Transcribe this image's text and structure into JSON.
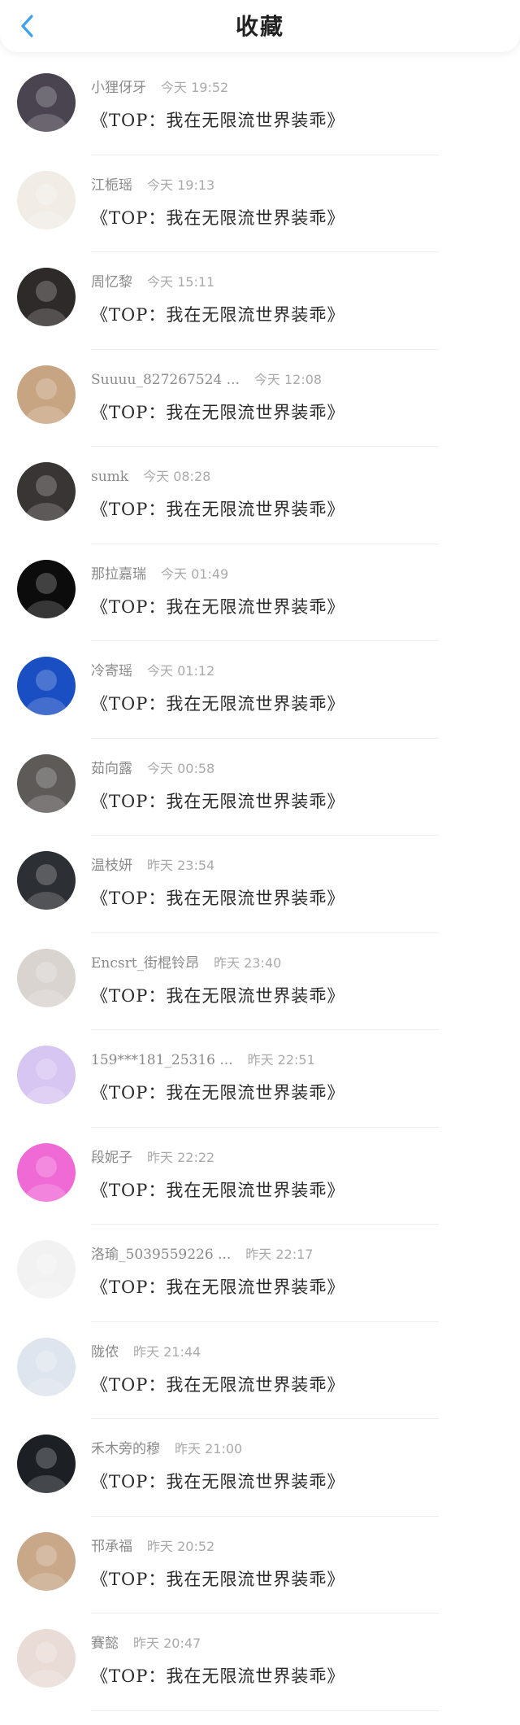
{
  "header": {
    "title": "收藏",
    "back_icon": "chevron-left-icon",
    "accent": "#3aa0f0"
  },
  "items": [
    {
      "name": "小狸伢牙",
      "time": "今天 19:52",
      "book": "《TOP：我在无限流世界装乖》",
      "avatar_color": "#4a4450"
    },
    {
      "name": "江栀瑶",
      "time": "今天 19:13",
      "book": "《TOP：我在无限流世界装乖》",
      "avatar_color": "#f1ece6"
    },
    {
      "name": "周忆黎",
      "time": "今天 15:11",
      "book": "《TOP：我在无限流世界装乖》",
      "avatar_color": "#2f2a2a"
    },
    {
      "name": "Suuuu_827267524 ...",
      "time": "今天 12:08",
      "book": "《TOP：我在无限流世界装乖》",
      "avatar_color": "#c8a582"
    },
    {
      "name": "sumk",
      "time": "今天 08:28",
      "book": "《TOP：我在无限流世界装乖》",
      "avatar_color": "#3a3535"
    },
    {
      "name": "那拉嘉瑞",
      "time": "今天 01:49",
      "book": "《TOP：我在无限流世界装乖》",
      "avatar_color": "#0c0c0c"
    },
    {
      "name": "冷寄瑶",
      "time": "今天 01:12",
      "book": "《TOP：我在无限流世界装乖》",
      "avatar_color": "#1a4fc4"
    },
    {
      "name": "茹向露",
      "time": "今天 00:58",
      "book": "《TOP：我在无限流世界装乖》",
      "avatar_color": "#5d5a58"
    },
    {
      "name": "温枝妍",
      "time": "昨天 23:54",
      "book": "《TOP：我在无限流世界装乖》",
      "avatar_color": "#2c2f33"
    },
    {
      "name": "Encsrt_街棍铃昂",
      "time": "昨天 23:40",
      "book": "《TOP：我在无限流世界装乖》",
      "avatar_color": "#d9d4d0"
    },
    {
      "name": "159***181_25316 ...",
      "time": "昨天 22:51",
      "book": "《TOP：我在无限流世界装乖》",
      "avatar_color": "#d8c6f2"
    },
    {
      "name": "段妮子",
      "time": "昨天 22:22",
      "book": "《TOP：我在无限流世界装乖》",
      "avatar_color": "#f06ad6"
    },
    {
      "name": "洛瑜_5039559226 ...",
      "time": "昨天 22:17",
      "book": "《TOP：我在无限流世界装乖》",
      "avatar_color": "#f2f2f2"
    },
    {
      "name": "陇侬",
      "time": "昨天 21:44",
      "book": "《TOP：我在无限流世界装乖》",
      "avatar_color": "#dfe5ee"
    },
    {
      "name": "禾木旁的穆",
      "time": "昨天 21:00",
      "book": "《TOP：我在无限流世界装乖》",
      "avatar_color": "#1c1f24"
    },
    {
      "name": "邗承福",
      "time": "昨天 20:52",
      "book": "《TOP：我在无限流世界装乖》",
      "avatar_color": "#c9a88a"
    },
    {
      "name": "賽懿",
      "time": "昨天 20:47",
      "book": "《TOP：我在无限流世界装乖》",
      "avatar_color": "#e9dcd6"
    }
  ]
}
